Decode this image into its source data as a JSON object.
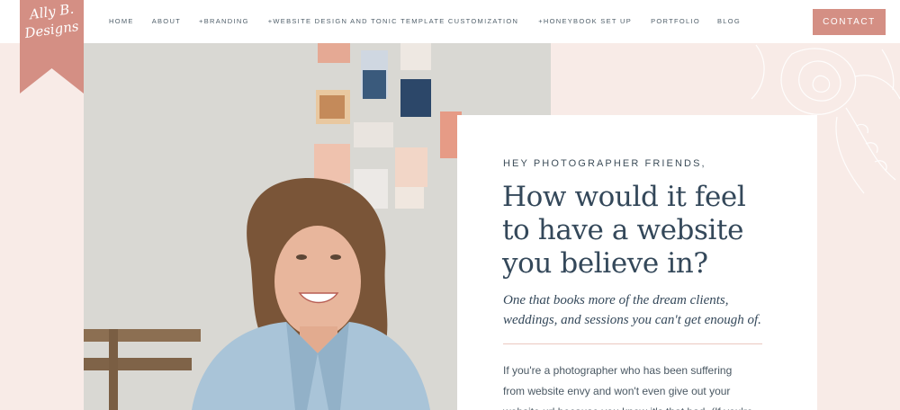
{
  "brand": {
    "logo_line1": "Ally B.",
    "logo_line2": "Designs",
    "accent_color": "#d48f84",
    "background_color": "#f8ebe7",
    "text_color": "#34485a"
  },
  "nav": {
    "items": [
      {
        "label": "HOME"
      },
      {
        "label": "ABOUT"
      },
      {
        "label": "+BRANDING"
      },
      {
        "label": "+WEBSITE DESIGN AND TONIC TEMPLATE CUSTOMIZATION"
      },
      {
        "label": "+HONEYBOOK SET UP"
      },
      {
        "label": "PORTFOLIO"
      },
      {
        "label": "BLOG"
      }
    ],
    "contact_label": "CONTACT"
  },
  "hero": {
    "eyebrow": "HEY PHOTOGRAPHER FRIENDS,",
    "headline_lines": [
      "How would it feel",
      "to have a website",
      "you believe in?"
    ],
    "subhead_lines": [
      "One that books more of the dream clients,",
      "weddings,  and sessions you can't get enough of."
    ],
    "body_lines": [
      "If you're a photographer who has been suffering",
      "from website envy and won't even give out your",
      "website url because you know it's that bad. (If you're"
    ]
  }
}
